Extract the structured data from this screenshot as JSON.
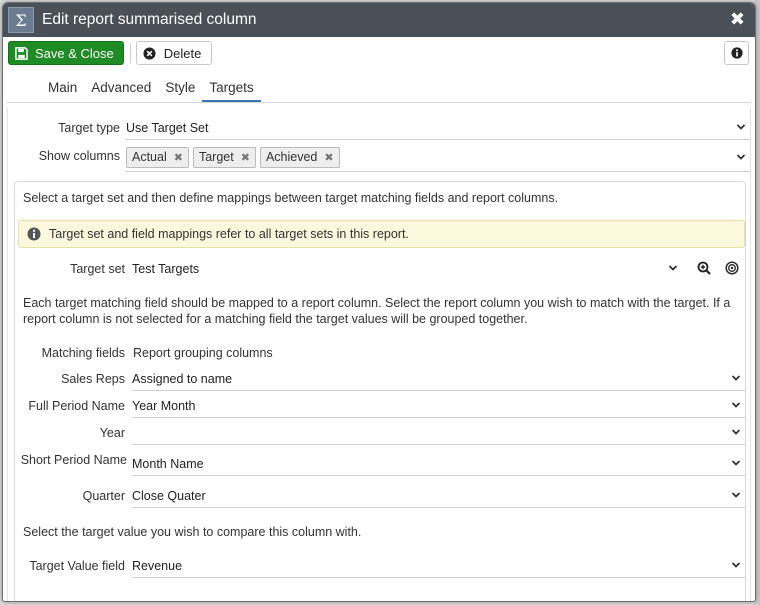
{
  "dialog": {
    "title": "Edit report summarised column",
    "title_icon": "Σ",
    "close_glyph": "✖"
  },
  "toolbar": {
    "save_label": "Save & Close",
    "delete_label": "Delete"
  },
  "tabs": [
    {
      "label": "Main",
      "active": false
    },
    {
      "label": "Advanced",
      "active": false
    },
    {
      "label": "Style",
      "active": false
    },
    {
      "label": "Targets",
      "active": true
    }
  ],
  "top": {
    "target_type_label": "Target type",
    "target_type_value": "Use Target Set",
    "show_columns_label": "Show columns",
    "show_columns_tags": [
      "Actual",
      "Target",
      "Achieved"
    ]
  },
  "panel": {
    "intro": "Select a target set and then define mappings between target matching fields and report columns.",
    "notice": "Target set and field mappings refer to all target sets in this report.",
    "target_set_label": "Target set",
    "target_set_value": "Test Targets",
    "mapping_help": "Each target matching field should be mapped to a report column. Select the report column you wish to match with the target. If a report column is not selected for a matching field the target values will be grouped together.",
    "matching_fields_label": "Matching fields",
    "matching_fields_value": "Report grouping columns",
    "mappings": [
      {
        "label": "Sales Reps",
        "value": "Assigned to name"
      },
      {
        "label": "Full Period Name",
        "value": "Year Month"
      },
      {
        "label": "Year",
        "value": ""
      },
      {
        "label": "Short Period Name",
        "value": "Month Name"
      },
      {
        "label": "Quarter",
        "value": "Close Quater"
      }
    ],
    "compare_help": "Select the target value you wish to compare this column with.",
    "target_value_label": "Target Value field",
    "target_value_value": "Revenue"
  },
  "colors": {
    "titlebar": "#4a5057",
    "save_button": "#1f8b24",
    "active_tab": "#3a78b5",
    "notice_bg": "#fcf8dd"
  },
  "icons": {
    "save": "floppy-disk-icon",
    "delete": "times-circle-icon",
    "info": "info-icon",
    "notice": "info-circle-icon",
    "zoom": "zoom-in-icon",
    "target": "target-icon",
    "dropdown": "chevron-down-icon"
  }
}
